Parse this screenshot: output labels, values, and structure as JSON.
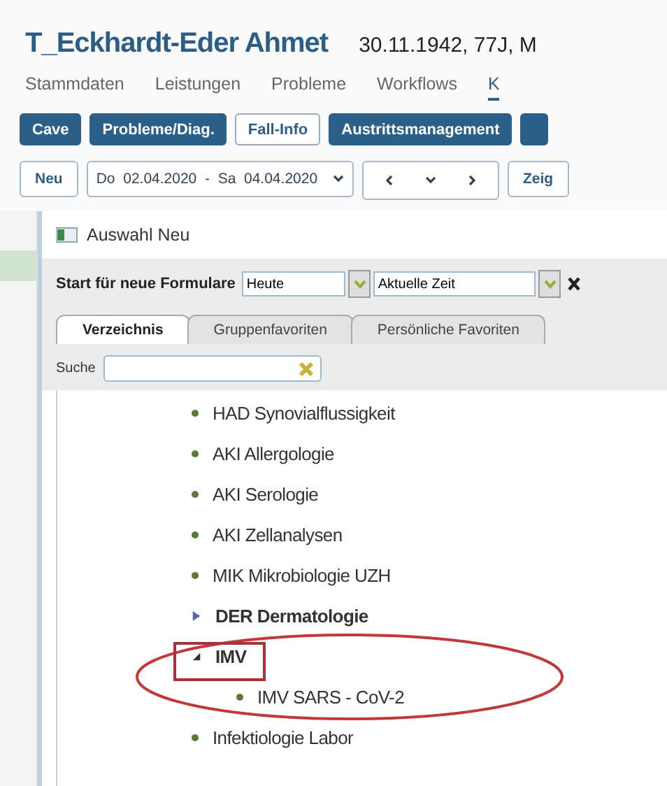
{
  "patient": {
    "name": "T_Eckhardt-Eder Ahmet",
    "details": "30.11.1942, 77J, M"
  },
  "nav_tabs": [
    {
      "label": "Stammdaten",
      "selected": false
    },
    {
      "label": "Leistungen",
      "selected": false
    },
    {
      "label": "Probleme",
      "selected": false
    },
    {
      "label": "Workflows",
      "selected": false
    },
    {
      "label": "K",
      "selected": true
    }
  ],
  "action_buttons": [
    {
      "label": "Cave",
      "selected": false
    },
    {
      "label": "Probleme/Diag.",
      "selected": false
    },
    {
      "label": "Fall-Info",
      "selected": true
    },
    {
      "label": "Austrittsmanagement",
      "selected": false
    }
  ],
  "toolbar": {
    "new_button": "Neu",
    "date_range": "Do  02.04.2020  -  Sa  04.04.2020",
    "show_button": "Zeig"
  },
  "dialog": {
    "title": "Auswahl Neu",
    "start_label": "Start für neue Formulare",
    "date_value": "Heute",
    "time_value": "Aktuelle Zeit",
    "tabs": [
      {
        "label": "Verzeichnis",
        "selected": true
      },
      {
        "label": "Gruppenfavoriten",
        "selected": false
      },
      {
        "label": "Persönliche Favoriten",
        "selected": false
      }
    ],
    "search_label": "Suche",
    "tree": [
      {
        "label": "HAD Synovialflussigkeit"
      },
      {
        "label": "AKI Allergologie"
      },
      {
        "label": "AKI Serologie"
      },
      {
        "label": "AKI Zellanalysen"
      },
      {
        "label": "MIK Mikrobiologie UZH"
      },
      {
        "label": "DER Dermatologie",
        "expanded": false
      },
      {
        "label": "IMV",
        "expanded": true,
        "children": [
          {
            "label": "IMV SARS - CoV-2"
          }
        ]
      },
      {
        "label": "Infektiologie Labor"
      }
    ]
  }
}
